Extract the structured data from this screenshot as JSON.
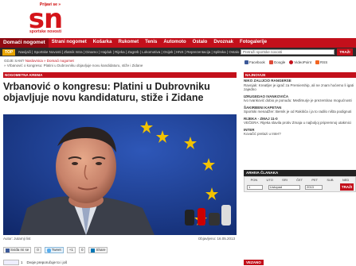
{
  "header": {
    "login_label": "Prijavi se »",
    "logo_text": "sn",
    "logo_subtitle": "sportske novosti"
  },
  "nav": {
    "items": [
      "Domaći nogomet",
      "Strani nogomet",
      "Košarka",
      "Rukomet",
      "Tenis",
      "Automoto",
      "Ostalo",
      "Dvoznak",
      "Fotogalerije"
    ]
  },
  "topbar": {
    "badge": "TOP",
    "ticker": "Navijači | Sportske Novosti | Zlatnik Istra | Dinamo | Hajduk | Rijeka | Zagreb | Lokomotiva | Osijek | HNS | Reprezentacija | Splitska | Ostalo | HNL | Video",
    "search_placeholder": "Pretraži sportske novosti",
    "search_button": "TRAŽI"
  },
  "breadcrumb": {
    "prefix": "GDJE SAM? ",
    "links": "Naslovnica » Domaći nogomet",
    "line2": "» Vrbanović o kongresu: Platini u Dubrovniku objavljuje novu kandidaturu, stiže i Zidane"
  },
  "article": {
    "section": "NOGOMETNA KREMA",
    "headline": "Vrbanović o kongresu: Platini u Dubrovniku objavljuje novu kandidaturu, stiže i Zidane",
    "author": "Autor: Jutarnji list",
    "published": "Objavljeno: 16.05.2013"
  },
  "share": {
    "email": "Sviđa mi se",
    "count": "0",
    "tweet": "Tweet",
    "gplus": "+1",
    "count2": "0",
    "share": "Share"
  },
  "bottom": {
    "recommend": "Dvoje preporučuje to i još",
    "like_count": "1"
  },
  "sidebar": {
    "social": [
      "Facebook",
      "Google",
      "VideoPoint",
      "RSS"
    ],
    "news_heading": "NAJNOVIJE",
    "news": [
      {
        "title": "NIKO ZALIJCIO RANGERSE",
        "text": "Ravnjak: Kreatljer je igrač za Premiership, ali ne znam hoćemo li igati zajedno"
      },
      {
        "title": "IZRUGEDAO IVANKOVIĆA",
        "text": "Ivo Ivanković dobio je ponudu: Međimurje je prezentirao mogućnosti"
      },
      {
        "title": "ŠAKIRBENI KAPETAN",
        "text": "Sportski menadžer: Bemik je od Rakitića i ja to radilo ništa podignuti"
      },
      {
        "title": "RIJEKA - ZMAJ 11-0",
        "text": "VEČERA: Rijeka slavila protiv Zmaja u najboljoj pripremnoj utakmici"
      },
      {
        "title": "INTER",
        "text": "Kovačić prelazi u Inter?"
      }
    ],
    "archive_heading": "ARHIVA ČLANAKA",
    "cal_days": [
      "PON",
      "UTO",
      "SRI",
      "ČET",
      "PET",
      "SUB",
      "NED"
    ],
    "cal_day_value": "1",
    "cal_month_value": "Listopad",
    "cal_year_value": "2013",
    "cal_button": "TRAŽI",
    "video_label": "VEZANO"
  },
  "colors": {
    "brand_red": "#c3101b",
    "dark_bar": "#2b2b2b",
    "eu_blue": "#1f3e8c"
  }
}
